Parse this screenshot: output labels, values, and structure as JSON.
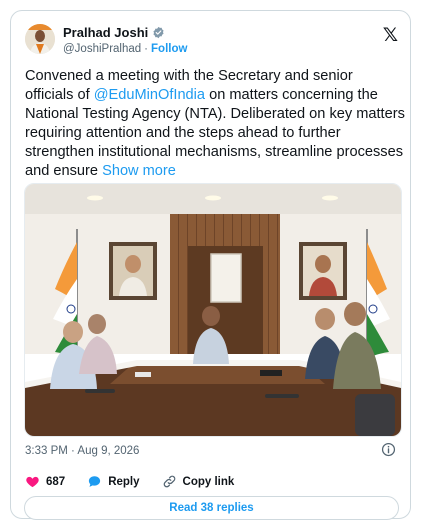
{
  "author": {
    "display_name": "Pralhad Joshi",
    "handle": "@JoshiPralhad",
    "separator": "·",
    "follow_label": "Follow"
  },
  "tweet": {
    "text_before": "Convened a meeting with the Secretary and senior officials of ",
    "mention": "@EduMinOfIndia",
    "text_after": " on matters concerning the National Testing Agency (NTA). Deliberated on key matters requiring attention and the steps ahead to further strengthen institutional mechanisms, streamline processes and ensure ",
    "show_more": "Show more"
  },
  "timestamp": "3:33 PM · Aug 9, 2026",
  "actions": {
    "like_count": "687",
    "reply_label": "Reply",
    "copy_link_label": "Copy link"
  },
  "read_replies_label": "Read 38 replies",
  "colors": {
    "accent": "#1d9bf0",
    "like": "#f91880",
    "text": "#0f1419",
    "muted": "#536471",
    "border": "#cfd9de"
  },
  "icons": [
    "verified-badge-icon",
    "x-logo-icon",
    "info-icon",
    "heart-icon",
    "reply-bubble-icon",
    "link-icon"
  ]
}
